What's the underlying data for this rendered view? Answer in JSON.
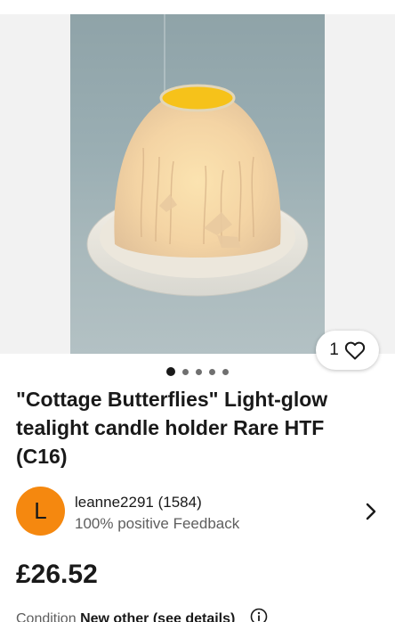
{
  "gallery": {
    "like_count": "1",
    "dots_total": 5,
    "dots_active_index": 0
  },
  "listing": {
    "title": "\"Cottage Butterflies\" Light-glow tealight candle holder Rare HTF (C16)",
    "price": "£26.52",
    "condition_label": "Condition",
    "condition_value": "New other (see details)"
  },
  "seller": {
    "initial": "L",
    "name": "leanne2291 (1584)",
    "feedback": "100% positive Feedback",
    "avatar_color": "#f5880f"
  },
  "icons": {
    "like": "heart-icon",
    "seller_link": "chevron-right-icon",
    "condition_info": "info-icon"
  }
}
